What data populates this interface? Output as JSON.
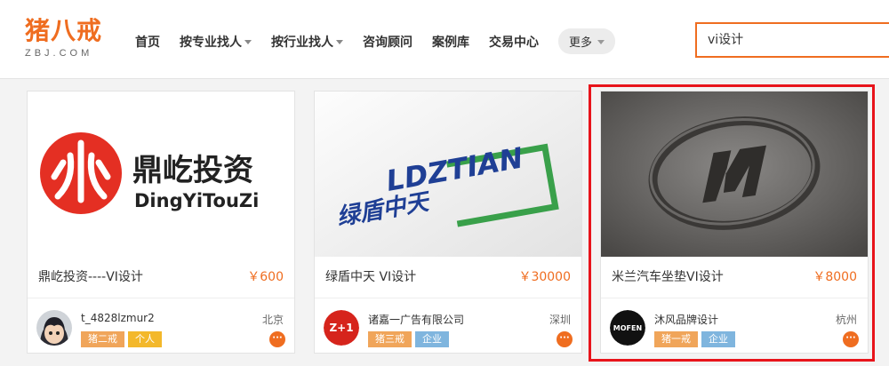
{
  "logo": {
    "main": "猪八戒",
    "sub": "ZBJ.COM"
  },
  "nav": {
    "items": [
      {
        "label": "首页",
        "caret": false
      },
      {
        "label": "按专业找人",
        "caret": true
      },
      {
        "label": "按行业找人",
        "caret": true
      },
      {
        "label": "咨询顾问",
        "caret": false
      },
      {
        "label": "案例库",
        "caret": false
      },
      {
        "label": "交易中心",
        "caret": false
      }
    ],
    "more_label": "更多"
  },
  "search": {
    "value": "vi设计"
  },
  "colors": {
    "brand": "#ef6d20",
    "highlight": "#e8141b"
  },
  "cards": [
    {
      "image_text_cn": "鼎屹投资",
      "image_text_en": "DingYiTouZi",
      "title": "鼎屹投资----VI设计",
      "price": "￥600",
      "seller": "t_4828lzmur2",
      "city": "北京",
      "level_tag": "猪二戒",
      "type_tag": "个人",
      "avatar_icon": "anime-avatar"
    },
    {
      "image_text_cn": "绿盾中天",
      "image_text_en": "LDZTIAN",
      "title": "绿盾中天 VI设计",
      "price": "￥30000",
      "seller": "诸嘉一广告有限公司",
      "city": "深圳",
      "level_tag": "猪三戒",
      "type_tag": "企业",
      "avatar_logo_text": "Z+1",
      "avatar_icon": "company-logo-avatar"
    },
    {
      "title": "米兰汽车坐垫VI设计",
      "price": "￥8000",
      "seller": "沐风品牌设计",
      "city": "杭州",
      "level_tag": "猪一戒",
      "type_tag": "企业",
      "avatar_logo_text": "MOFEN",
      "avatar_icon": "mofen-logo-avatar"
    }
  ]
}
